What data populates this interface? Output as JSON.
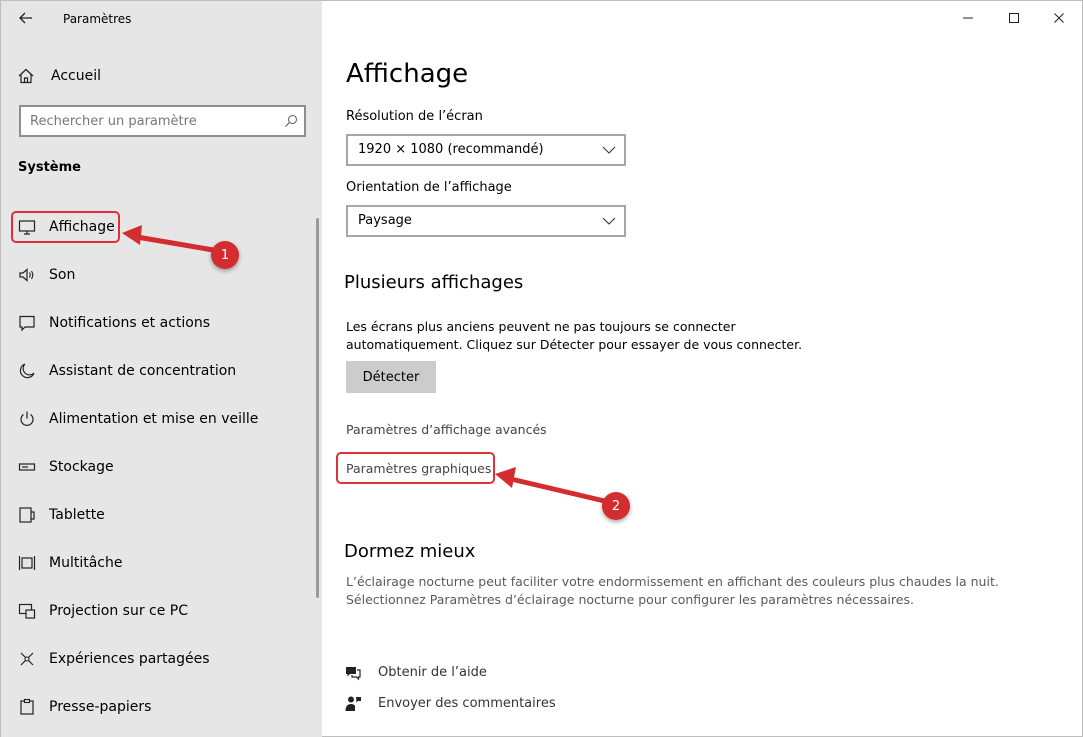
{
  "window": {
    "title": "Paramètres",
    "caption": {
      "minimize": "minimize-icon",
      "maximize": "maximize-icon",
      "close": "close-icon"
    }
  },
  "sidebar": {
    "home_label": "Accueil",
    "search_placeholder": "Rechercher un paramètre",
    "section_title": "Système",
    "items": [
      {
        "label": "Affichage",
        "icon": "monitor-icon"
      },
      {
        "label": "Son",
        "icon": "speaker-icon"
      },
      {
        "label": "Notifications et actions",
        "icon": "notification-icon"
      },
      {
        "label": "Assistant de concentration",
        "icon": "moon-icon"
      },
      {
        "label": "Alimentation et mise en veille",
        "icon": "power-icon"
      },
      {
        "label": "Stockage",
        "icon": "storage-icon"
      },
      {
        "label": "Tablette",
        "icon": "tablet-icon"
      },
      {
        "label": "Multitâche",
        "icon": "multitask-icon"
      },
      {
        "label": "Projection sur ce PC",
        "icon": "projection-icon"
      },
      {
        "label": "Expériences partagées",
        "icon": "shared-icon"
      },
      {
        "label": "Presse-papiers",
        "icon": "clipboard-icon"
      }
    ]
  },
  "main": {
    "title": "Affichage",
    "resolution_label": "Résolution de l’écran",
    "resolution_value": "1920 × 1080 (recommandé)",
    "orientation_label": "Orientation de l’affichage",
    "orientation_value": "Paysage",
    "multi_title": "Plusieurs affichages",
    "multi_desc_1": "Les écrans plus anciens peuvent ne pas toujours se connecter",
    "multi_desc_2": "automatiquement. Cliquez sur Détecter pour essayer de vous connecter.",
    "detect_button": "Détecter",
    "advanced_link": "Paramètres d’affichage avancés",
    "graphics_link": "Paramètres graphiques",
    "sleep_title": "Dormez mieux",
    "sleep_desc_1": "L’éclairage nocturne peut faciliter votre endormissement en affichant des couleurs plus chaudes la nuit.",
    "sleep_desc_2": "Sélectionnez Paramètres d’éclairage nocturne pour configurer les paramètres nécessaires.",
    "help_link": "Obtenir de l’aide",
    "feedback_link": "Envoyer des commentaires"
  },
  "annotations": {
    "badge_1": "1",
    "badge_2": "2",
    "color": "#d42d2f"
  }
}
